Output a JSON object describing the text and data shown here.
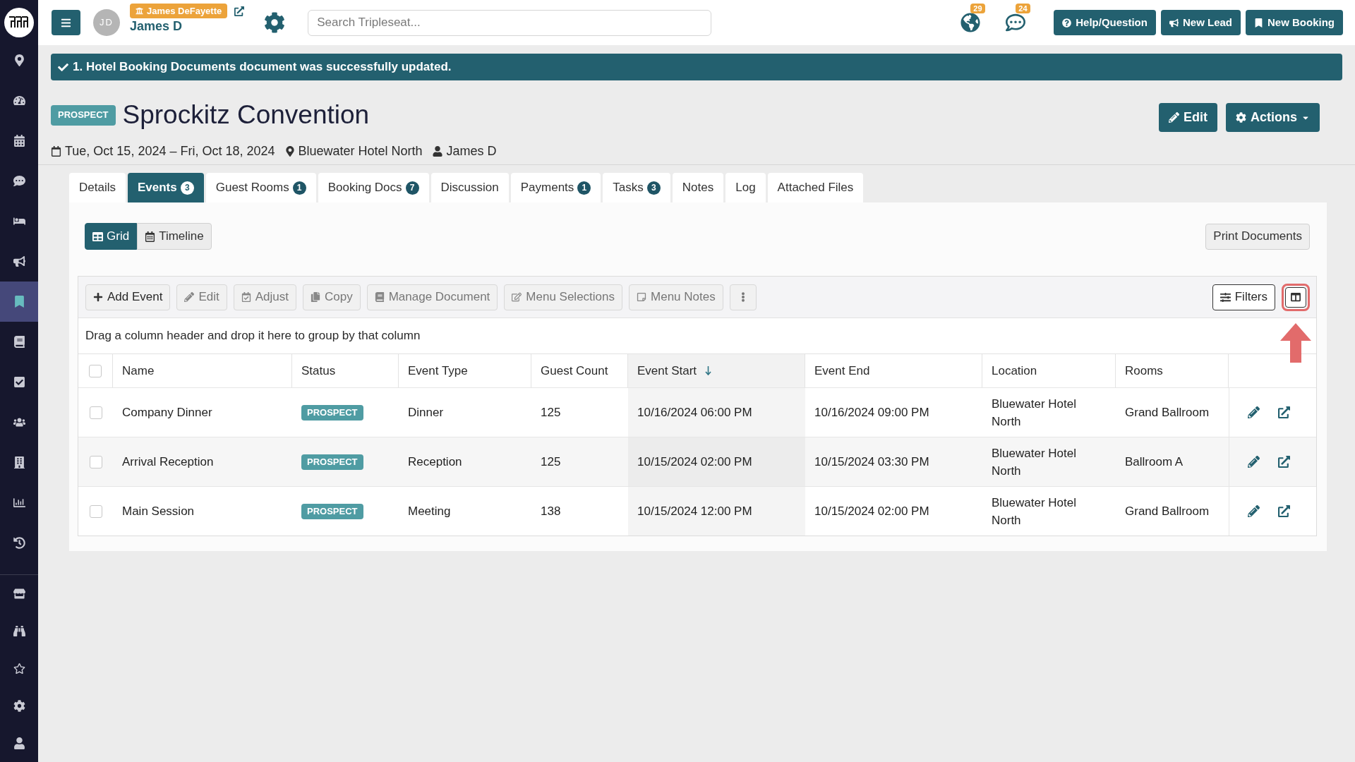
{
  "sidebar": {
    "main_items": [
      {
        "selected": false
      },
      {
        "selected": false
      },
      {
        "selected": false
      },
      {
        "selected": false
      },
      {
        "selected": false
      },
      {
        "selected": false
      },
      {
        "selected": true
      },
      {
        "selected": false
      },
      {
        "selected": false
      },
      {
        "selected": false
      },
      {
        "selected": false
      },
      {
        "selected": false
      },
      {
        "selected": false
      }
    ],
    "bottom_items": [
      {
        "selected": false
      },
      {
        "selected": false
      },
      {
        "selected": false
      },
      {
        "selected": false
      },
      {
        "selected": false
      }
    ]
  },
  "top_bar": {
    "user": {
      "initials": "JD",
      "account": "James DeFayette",
      "name": "James D"
    },
    "search": {
      "placeholder": "Search Tripleseat..."
    },
    "notifications": [
      {
        "count": "29"
      },
      {
        "count": "24"
      }
    ],
    "buttons": [
      "Help/Question",
      "New Lead",
      "New Booking"
    ]
  },
  "alert": {
    "message": "1. Hotel Booking Documents document was successfully updated."
  },
  "booking": {
    "status": "PROSPECT",
    "title": "Sprockitz Convention",
    "dates": "Tue, Oct 15, 2024 – Fri, Oct 18, 2024",
    "venue": "Bluewater Hotel North",
    "owner": "James D",
    "buttons": [
      "Edit",
      "Actions"
    ]
  },
  "tabs": [
    {
      "label": "Details",
      "selected": false
    },
    {
      "label": "Events",
      "count": "3",
      "selected": true
    },
    {
      "label": "Guest Rooms",
      "count": "1",
      "selected": false
    },
    {
      "label": "Booking Docs",
      "count": "7",
      "selected": false
    },
    {
      "label": "Discussion",
      "selected": false
    },
    {
      "label": "Payments",
      "count": "1",
      "selected": false
    },
    {
      "label": "Tasks",
      "count": "3",
      "selected": false
    },
    {
      "label": "Notes",
      "selected": false
    },
    {
      "label": "Log",
      "selected": false
    },
    {
      "label": "Attached Files",
      "selected": false
    }
  ],
  "events_panel": {
    "view_toggle": [
      {
        "label": "Grid",
        "selected": true
      },
      {
        "label": "Timeline",
        "selected": false
      }
    ],
    "print_button": "Print Documents",
    "toolbar": {
      "buttons": [
        {
          "label": "Add Event",
          "disabled": false
        },
        {
          "label": "Edit",
          "disabled": true
        },
        {
          "label": "Adjust",
          "disabled": true
        },
        {
          "label": "Copy",
          "disabled": true
        },
        {
          "label": "Manage Document",
          "disabled": true
        },
        {
          "label": "Menu Selections",
          "disabled": true
        },
        {
          "label": "Menu Notes",
          "disabled": true
        }
      ],
      "filters": "Filters",
      "column_chooser": {
        "highlighted": true
      }
    },
    "group_hint": "Drag a column header and drop it here to group by that column",
    "table": {
      "select_all_checked": false,
      "columns": [
        {
          "label": "Name",
          "sorted": false
        },
        {
          "label": "Status",
          "sorted": false
        },
        {
          "label": "Event Type",
          "sorted": false
        },
        {
          "label": "Guest Count",
          "sorted": false
        },
        {
          "label": "Event Start",
          "sorted": true
        },
        {
          "label": "Event End",
          "sorted": false
        },
        {
          "label": "Location",
          "sorted": false
        },
        {
          "label": "Rooms",
          "sorted": false
        }
      ],
      "rows": [
        {
          "checked": false,
          "name": "Company Dinner",
          "status": "PROSPECT",
          "event_type": "Dinner",
          "guest_count": "125",
          "event_start": "10/16/2024 06:00 PM",
          "event_end": "10/16/2024 09:00 PM",
          "location": "Bluewater Hotel North",
          "rooms": "Grand Ballroom"
        },
        {
          "checked": false,
          "name": "Arrival Reception",
          "status": "PROSPECT",
          "event_type": "Reception",
          "guest_count": "125",
          "event_start": "10/15/2024 02:00 PM",
          "event_end": "10/15/2024 03:30 PM",
          "location": "Bluewater Hotel North",
          "rooms": "Ballroom A"
        },
        {
          "checked": false,
          "name": "Main Session",
          "status": "PROSPECT",
          "event_type": "Meeting",
          "guest_count": "138",
          "event_start": "10/15/2024 12:00 PM",
          "event_end": "10/15/2024 02:00 PM",
          "location": "Bluewater Hotel North",
          "rooms": "Grand Ballroom"
        }
      ]
    }
  }
}
